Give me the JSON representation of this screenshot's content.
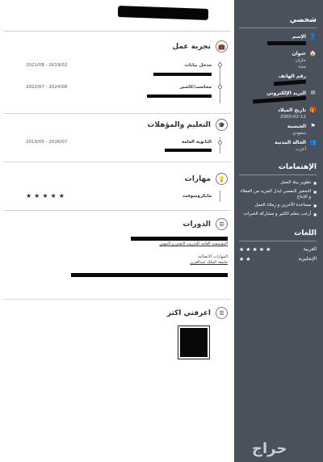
{
  "sidebar": {
    "personal_heading": "شخصي",
    "name_label": "الإسم",
    "address_label": "عنوان",
    "address_line1": "جازان",
    "address_line2": "جدة",
    "phone_label": "رقم الهاتف",
    "email_label": "البريد الإلكتروني",
    "birth_label": "تاريخ الميلاد",
    "birth_value": "2000-02-12",
    "nationality_label": "الجنسية",
    "nationality_value": "سعودي",
    "marital_label": "الحالة المدنية",
    "marital_value": "أعزب",
    "interests_heading": "الإهتمامات",
    "interests": [
      "تطوير بيئة العمل",
      "التحفيز النفسي لبذل المزيد من العطاء و الإنتاج",
      "مساعدة الآخرين و زملاء العمل",
      "أرغب بتعلم الكثير و مشاركة الخبرات"
    ],
    "languages_heading": "اللغات",
    "languages": [
      {
        "name": "العربية",
        "stars": "★★★★★"
      },
      {
        "name": "الإنجليزية",
        "stars": "★★"
      }
    ],
    "watermark": "حراج"
  },
  "experience": {
    "heading": "تجربة عمل",
    "items": [
      {
        "title": "مدخل بيانات",
        "date": "2019/02 - 2021/08"
      },
      {
        "title": "محاسب/كاشير",
        "date": "2024/08 - 2022/07"
      }
    ]
  },
  "education": {
    "heading": "التعليم والمؤهلات",
    "items": [
      {
        "title": "الثانوية العامة",
        "date": "2016/07 - 2019/05"
      }
    ]
  },
  "skills": {
    "heading": "مهارات",
    "items": [
      {
        "name": "مايكروسوفت",
        "stars": "★★★★★"
      }
    ]
  },
  "courses": {
    "heading": "الدورات",
    "org1": "المؤسسة العامة للتدريب التقني و المهني",
    "course2": "المهارات الاتصالية",
    "org2": "جامعة الملك عبدالعزيز"
  },
  "more": {
    "heading": "اعرفني اكثر"
  }
}
